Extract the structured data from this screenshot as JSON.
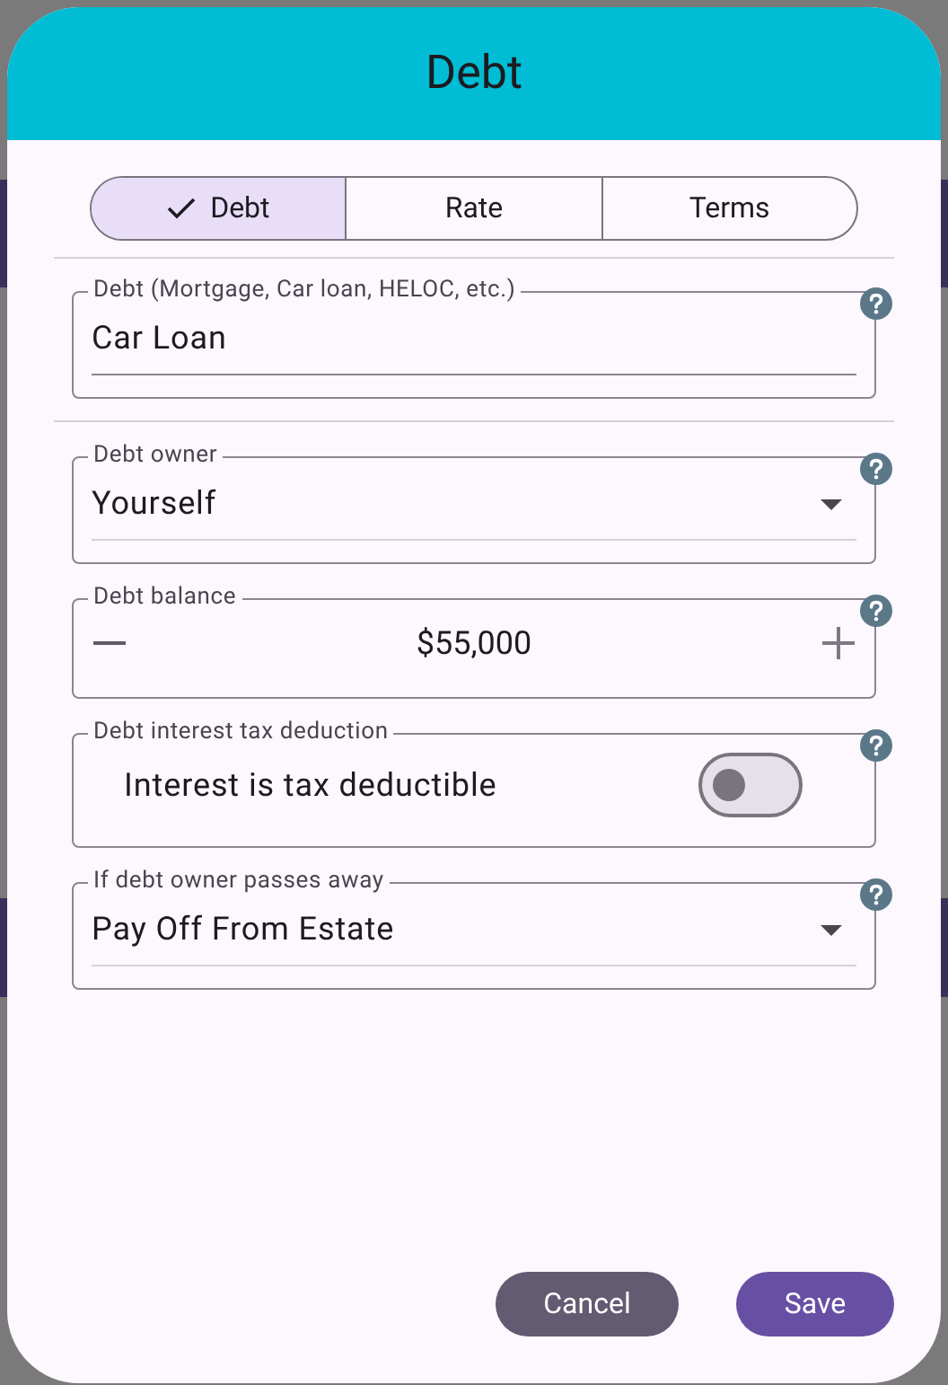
{
  "dialog": {
    "title": "Debt"
  },
  "tabs": [
    {
      "label": "Debt",
      "selected": true
    },
    {
      "label": "Rate",
      "selected": false
    },
    {
      "label": "Terms",
      "selected": false
    }
  ],
  "fields": [
    {
      "kind": "text",
      "label": "Debt (Mortgage, Car loan, HELOC, etc.)",
      "value": "Car Loan",
      "divider_after": true
    },
    {
      "kind": "select",
      "label": "Debt owner",
      "value": "Yourself"
    },
    {
      "kind": "stepper",
      "label": "Debt balance",
      "value": "$55,000"
    },
    {
      "kind": "switch",
      "label": "Debt interest tax deduction",
      "text": "Interest is tax deductible",
      "on": false
    },
    {
      "kind": "select",
      "label": "If debt owner passes away",
      "value": "Pay Off From Estate"
    }
  ],
  "buttons": [
    {
      "kind": "secondary",
      "label": "Cancel"
    },
    {
      "kind": "primary",
      "label": "Save"
    }
  ]
}
